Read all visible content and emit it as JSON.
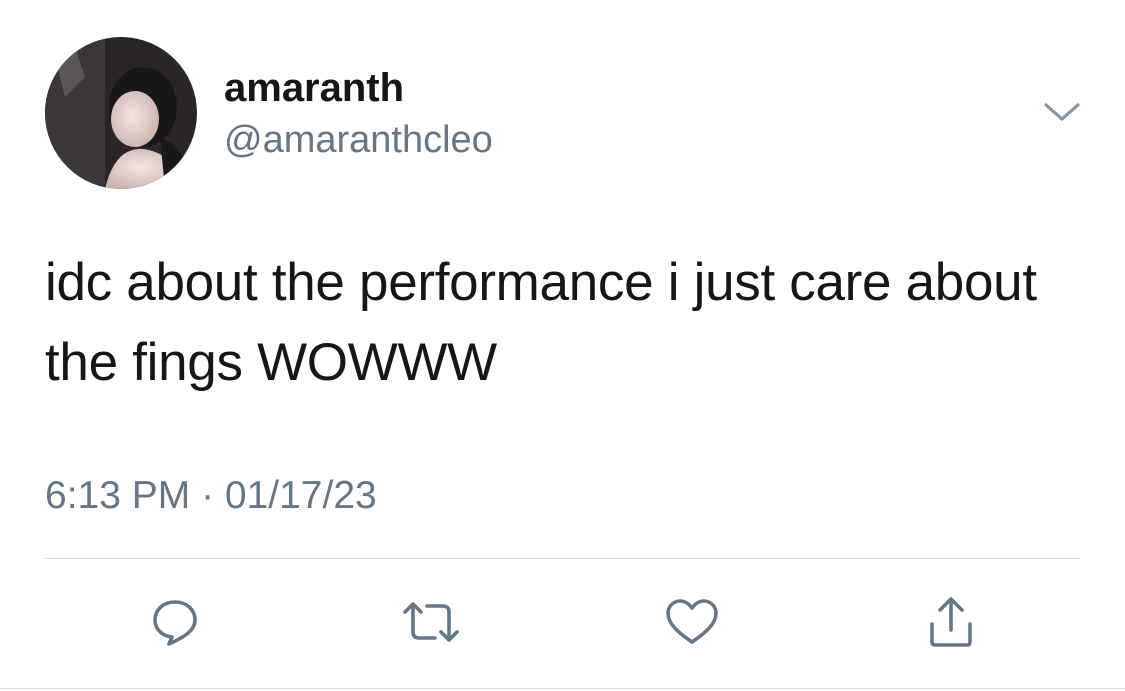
{
  "author": {
    "display_name": "amaranth",
    "handle": "@amaranthcleo",
    "avatar_icon": "user-avatar-photo"
  },
  "tweet": {
    "text": "idc about the performance i just care about the fings WOWWW",
    "timestamp": "6:13 PM · 01/17/23"
  },
  "actions": [
    {
      "icon": "reply-icon"
    },
    {
      "icon": "retweet-icon"
    },
    {
      "icon": "like-icon"
    },
    {
      "icon": "share-icon"
    }
  ],
  "colors": {
    "text_primary": "#14171a",
    "text_secondary": "#657786",
    "icon_gray": "#657786",
    "divider": "#d8dde1"
  }
}
